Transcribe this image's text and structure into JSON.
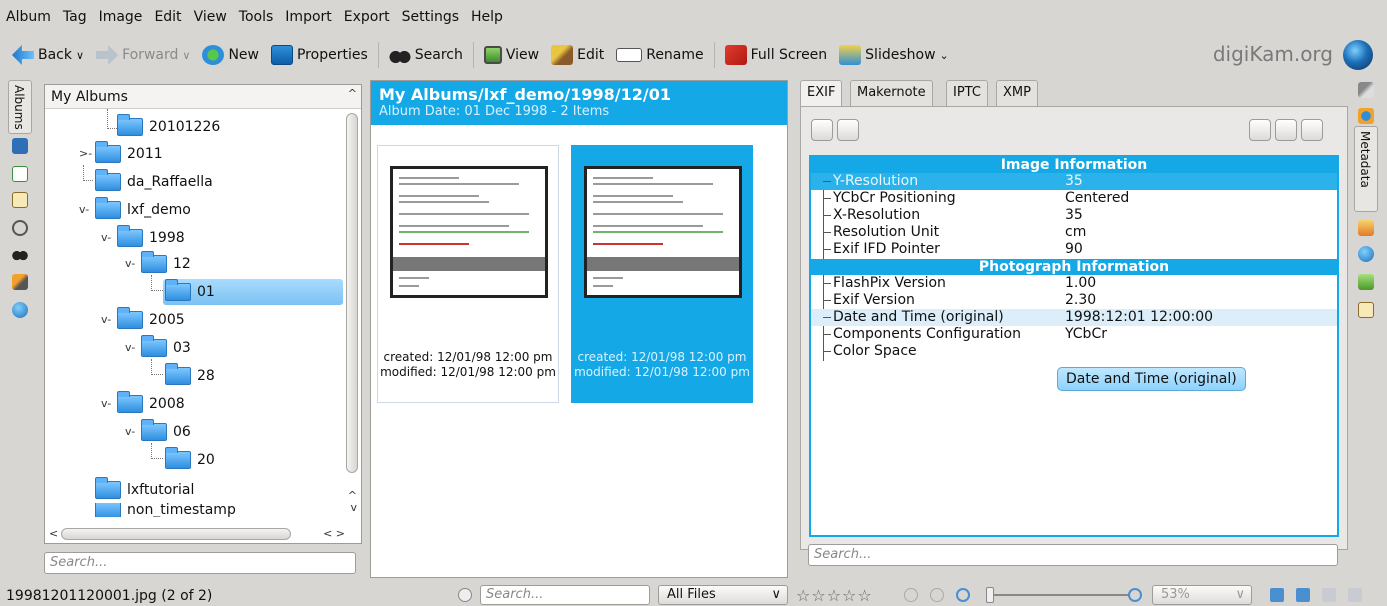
{
  "menu": [
    "Album",
    "Tag",
    "Image",
    "Edit",
    "View",
    "Tools",
    "Import",
    "Export",
    "Settings",
    "Help"
  ],
  "toolbar": {
    "back": "Back",
    "forward": "Forward",
    "new": "New",
    "properties": "Properties",
    "search": "Search",
    "view": "View",
    "edit": "Edit",
    "rename": "Rename",
    "full_screen": "Full Screen",
    "slideshow": "Slideshow",
    "brand": "digiKam.org"
  },
  "left_tab": "Albums",
  "right_tab": "Metadata",
  "tree": {
    "header": "My Albums",
    "items": [
      "20101226",
      "2011",
      "da_Raffaella",
      "lxf_demo",
      "1998",
      "12",
      "01",
      "2005",
      "03",
      "28",
      "2008",
      "06",
      "20",
      "lxftutorial",
      "non_timestamp"
    ],
    "search_placeholder": "Search..."
  },
  "album": {
    "path": "My Albums/lxf_demo/1998/12/01",
    "info": "Album Date: 01 Dec 1998 - 2 Items",
    "thumbs": [
      {
        "created": "created: 12/01/98 12:00 pm",
        "modified": "modified: 12/01/98 12:00 pm"
      },
      {
        "created": "created: 12/01/98 12:00 pm",
        "modified": "modified: 12/01/98 12:00 pm"
      }
    ]
  },
  "metadata": {
    "tabs": [
      "EXIF",
      "Makernote",
      "IPTC",
      "XMP"
    ],
    "sections": [
      "Image Information",
      "Photograph Information"
    ],
    "rows": [
      {
        "key": "Y-Resolution",
        "value": "35"
      },
      {
        "key": "YCbCr Positioning",
        "value": "Centered"
      },
      {
        "key": "X-Resolution",
        "value": "35"
      },
      {
        "key": "Resolution Unit",
        "value": "cm"
      },
      {
        "key": "Exif IFD Pointer",
        "value": "90"
      },
      {
        "key": "FlashPix Version",
        "value": "1.00"
      },
      {
        "key": "Exif Version",
        "value": "2.30"
      },
      {
        "key": "Date and Time (original)",
        "value": "1998:12:01 12:00:00"
      },
      {
        "key": "Components Configuration",
        "value": "YCbCr"
      },
      {
        "key": "Color Space",
        "value": ""
      }
    ],
    "tooltip": "Date and Time (original)",
    "search_placeholder": "Search..."
  },
  "status": {
    "file": "19981201120001.jpg (2 of 2)",
    "search_placeholder": "Search...",
    "filter": "All Files",
    "zoom": "53%"
  },
  "colors": {
    "accent": "#15a8e6",
    "window": "#d8d6d3"
  }
}
